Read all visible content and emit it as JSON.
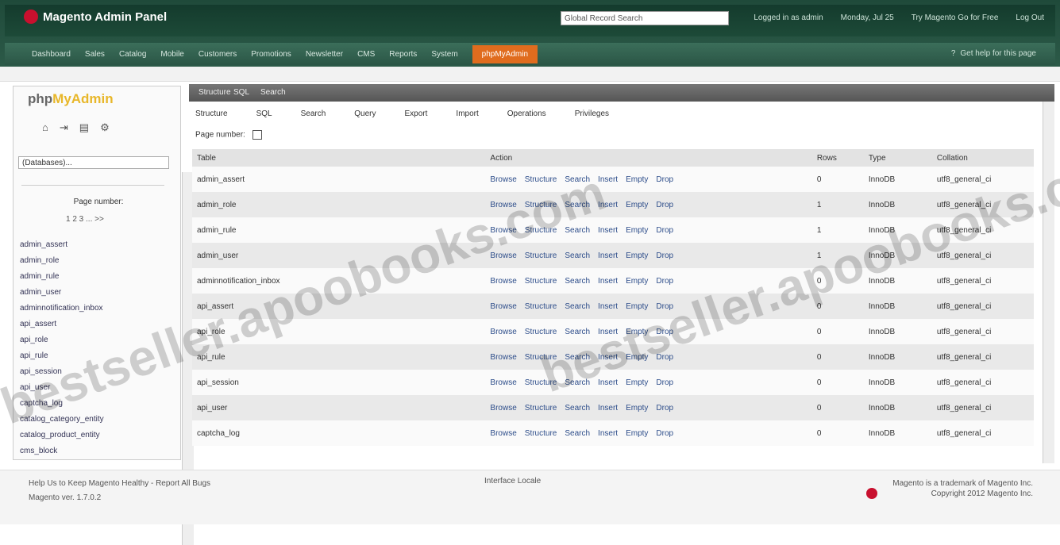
{
  "header": {
    "app_title": "Magento Admin Panel",
    "search_placeholder": "Global Record Search",
    "links": [
      "Logged in as admin",
      "Monday, Jul 25",
      "Try Magento Go for Free",
      "Log Out"
    ],
    "nav": [
      "Dashboard",
      "Sales",
      "Catalog",
      "Mobile",
      "Customers",
      "Promotions",
      "Newsletter",
      "CMS",
      "Reports",
      "System",
      "phpMyAdmin"
    ],
    "active_nav": "phpMyAdmin",
    "nav_right": "Get help for this page"
  },
  "sidebar": {
    "logo_prefix": "php",
    "logo_suffix": "MyAdmin",
    "icons": [
      "home-icon",
      "logout-icon",
      "sql-icon",
      "settings-icon"
    ],
    "db_select": "(Databases)...",
    "page_nav": "Page number:",
    "page_nav_sub": "1 2 3 ... >>",
    "tables": [
      "admin_assert",
      "admin_role",
      "admin_rule",
      "admin_user",
      "adminnotification_inbox",
      "api_assert",
      "api_role",
      "api_rule",
      "api_session",
      "api_user",
      "captcha_log",
      "catalog_category_entity",
      "catalog_product_entity",
      "cms_block"
    ]
  },
  "main": {
    "tabs": [
      "Structure",
      "SQL",
      "Search",
      "Query",
      "Export",
      "Import",
      "Operations",
      "Privileges"
    ],
    "toolbar": [
      "Structure",
      "SQL",
      "Search",
      "Query",
      "Export",
      "Import",
      "Operations",
      "Privileges"
    ],
    "showing_label": "Page number:",
    "columns": [
      "Table",
      "Action",
      "Rows",
      "Type",
      "Collation"
    ],
    "rows": [
      {
        "name": "admin_assert",
        "rows": "0",
        "type": "InnoDB",
        "coll": "utf8_general_ci"
      },
      {
        "name": "admin_role",
        "rows": "1",
        "type": "InnoDB",
        "coll": "utf8_general_ci"
      },
      {
        "name": "admin_rule",
        "rows": "1",
        "type": "InnoDB",
        "coll": "utf8_general_ci"
      },
      {
        "name": "admin_user",
        "rows": "1",
        "type": "InnoDB",
        "coll": "utf8_general_ci"
      },
      {
        "name": "adminnotification_inbox",
        "rows": "0",
        "type": "InnoDB",
        "coll": "utf8_general_ci"
      },
      {
        "name": "api_assert",
        "rows": "0",
        "type": "InnoDB",
        "coll": "utf8_general_ci"
      },
      {
        "name": "api_role",
        "rows": "0",
        "type": "InnoDB",
        "coll": "utf8_general_ci"
      },
      {
        "name": "api_rule",
        "rows": "0",
        "type": "InnoDB",
        "coll": "utf8_general_ci"
      },
      {
        "name": "api_session",
        "rows": "0",
        "type": "InnoDB",
        "coll": "utf8_general_ci"
      },
      {
        "name": "api_user",
        "rows": "0",
        "type": "InnoDB",
        "coll": "utf8_general_ci"
      },
      {
        "name": "captcha_log",
        "rows": "0",
        "type": "InnoDB",
        "coll": "utf8_general_ci"
      }
    ],
    "row_actions": [
      "Browse",
      "Structure",
      "Search",
      "Insert",
      "Empty",
      "Drop"
    ]
  },
  "footer": {
    "left_line1": "Help Us to Keep Magento Healthy - Report All Bugs",
    "left_line2": "Magento ver. 1.7.0.2",
    "mid": "Interface Locale",
    "right_line1": "Magento is a trademark of Magento Inc.",
    "right_line2": "Copyright 2012 Magento Inc."
  },
  "watermark": "bestseller.apoobooks.com"
}
